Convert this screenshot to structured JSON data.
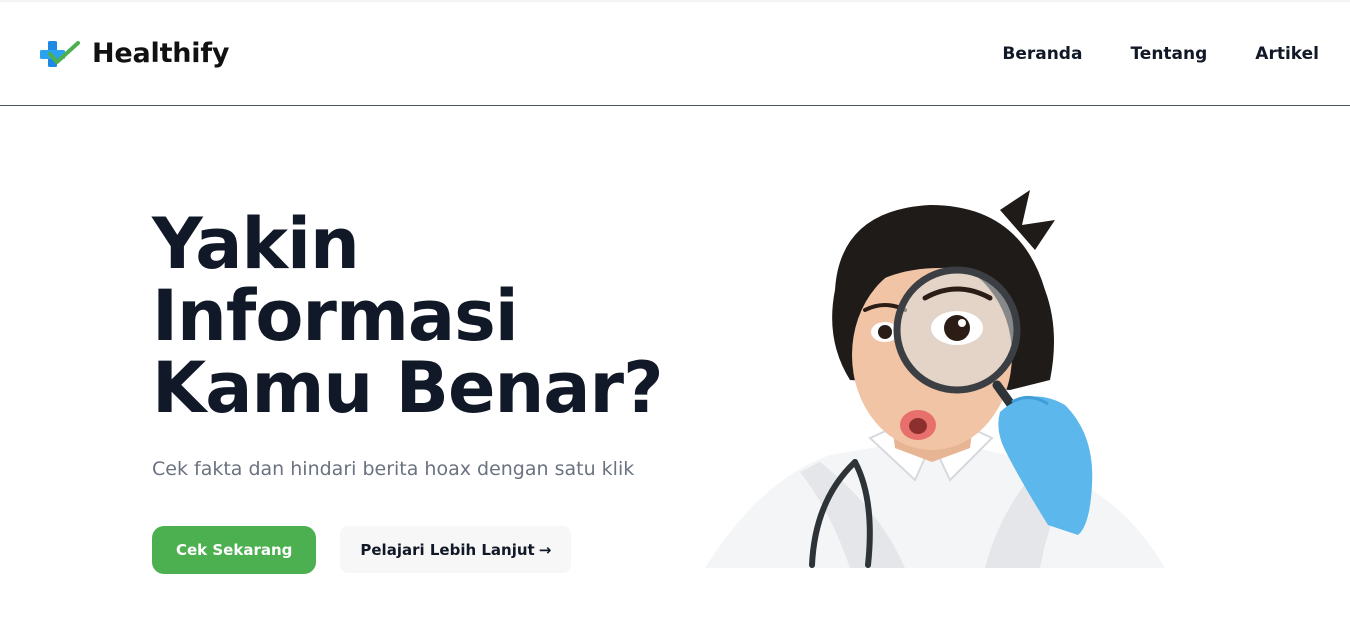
{
  "brand": {
    "name": "Healthify",
    "logo": "medical-cross-check-logo"
  },
  "nav": {
    "items": [
      "Beranda",
      "Tentang",
      "Artikel"
    ]
  },
  "hero": {
    "title_lines": [
      "Yakin",
      "Informasi",
      "Kamu Benar?"
    ],
    "subtitle": "Cek fakta dan hindari berita hoax dengan satu klik",
    "primary_button": "Cek Sekarang",
    "secondary_button": "Pelajari Lebih Lanjut",
    "secondary_arrow": "→",
    "image": "doctor-with-magnifying-glass"
  },
  "colors": {
    "primary": "#4caf50",
    "text": "#111827",
    "muted": "#6b7280",
    "logo_blue": "#1e88e5",
    "logo_green": "#4caf50"
  }
}
